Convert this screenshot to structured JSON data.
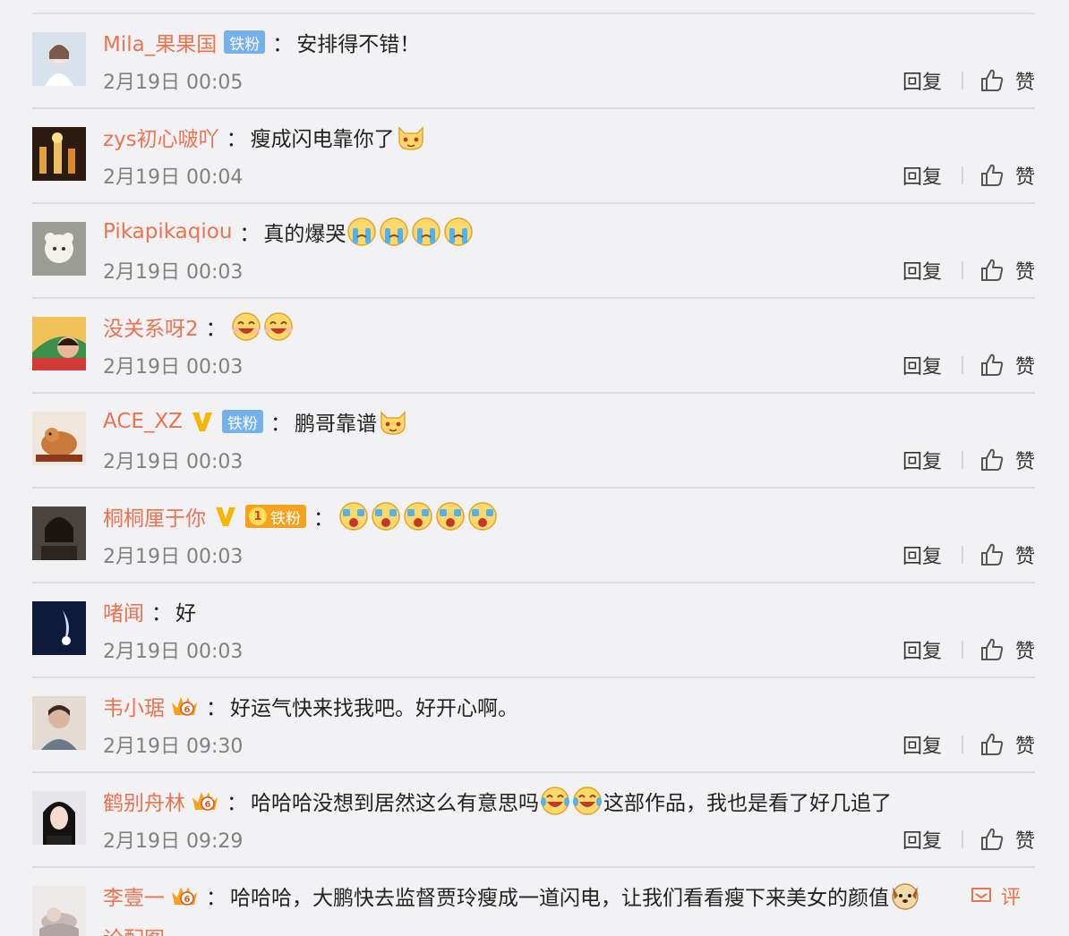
{
  "labels": {
    "reply": "回复",
    "like": "赞",
    "comment": "评",
    "colon": "："
  },
  "colors": {
    "username": "#eb7350",
    "fan_badge": "#74b0ea",
    "gold_fan_badge": "#f6a21e",
    "verified_v": "#f7b500",
    "time": "#808080"
  },
  "comments": [
    {
      "user": "Mila_果果国",
      "fan_badge": "铁粉",
      "text": "安排得不错！",
      "time": "2月19日 00:05"
    },
    {
      "user": "zys初心啵吖",
      "text": "瘦成闪电靠你了",
      "emoji": [
        "cat-face-emoji"
      ],
      "time": "2月19日 00:04"
    },
    {
      "user": "Pikapikaqiou",
      "text": "真的爆哭",
      "emoji": [
        "crying-face-emoji",
        "crying-face-emoji",
        "crying-face-emoji",
        "crying-face-emoji"
      ],
      "time": "2月19日 00:03"
    },
    {
      "user": "没关系呀2",
      "text": "",
      "emoji": [
        "laughing-face-emoji",
        "laughing-face-emoji"
      ],
      "time": "2月19日 00:03"
    },
    {
      "user": "ACE_XZ",
      "verified": true,
      "fan_badge": "铁粉",
      "text": "鹏哥靠谱",
      "emoji": [
        "cat-face-emoji"
      ],
      "time": "2月19日 00:03"
    },
    {
      "user": "桐桐厘于你",
      "verified": true,
      "gold_fan_badge": "铁粉",
      "gold_level": "1",
      "text": "",
      "emoji": [
        "wow-face-emoji",
        "wow-face-emoji",
        "wow-face-emoji",
        "wow-face-emoji",
        "wow-face-emoji"
      ],
      "time": "2月19日 00:03"
    },
    {
      "user": "啫闻",
      "text": "好",
      "time": "2月19日 00:03"
    },
    {
      "user": "韦小琚",
      "vip_level": "6",
      "text": "好运气快来找我吧。好开心啊。",
      "time": "2月19日 09:30"
    },
    {
      "user": "鹤别舟林",
      "vip_level": "6",
      "text_before": "哈哈哈没想到居然这么有意思吗",
      "emoji": [
        "tears-of-joy-emoji",
        "tears-of-joy-emoji"
      ],
      "text_after": "这部作品，我也是看了好几追了",
      "time": "2月19日 09:29"
    },
    {
      "user": "李壹一",
      "vip_level": "6",
      "text": "哈哈哈，大鹏快去监督贾玲瘦成一道闪电，让我们看看瘦下来美女的颜值",
      "emoji": [
        "dog-face-emoji"
      ],
      "continuation": "论配图",
      "time": ""
    }
  ]
}
